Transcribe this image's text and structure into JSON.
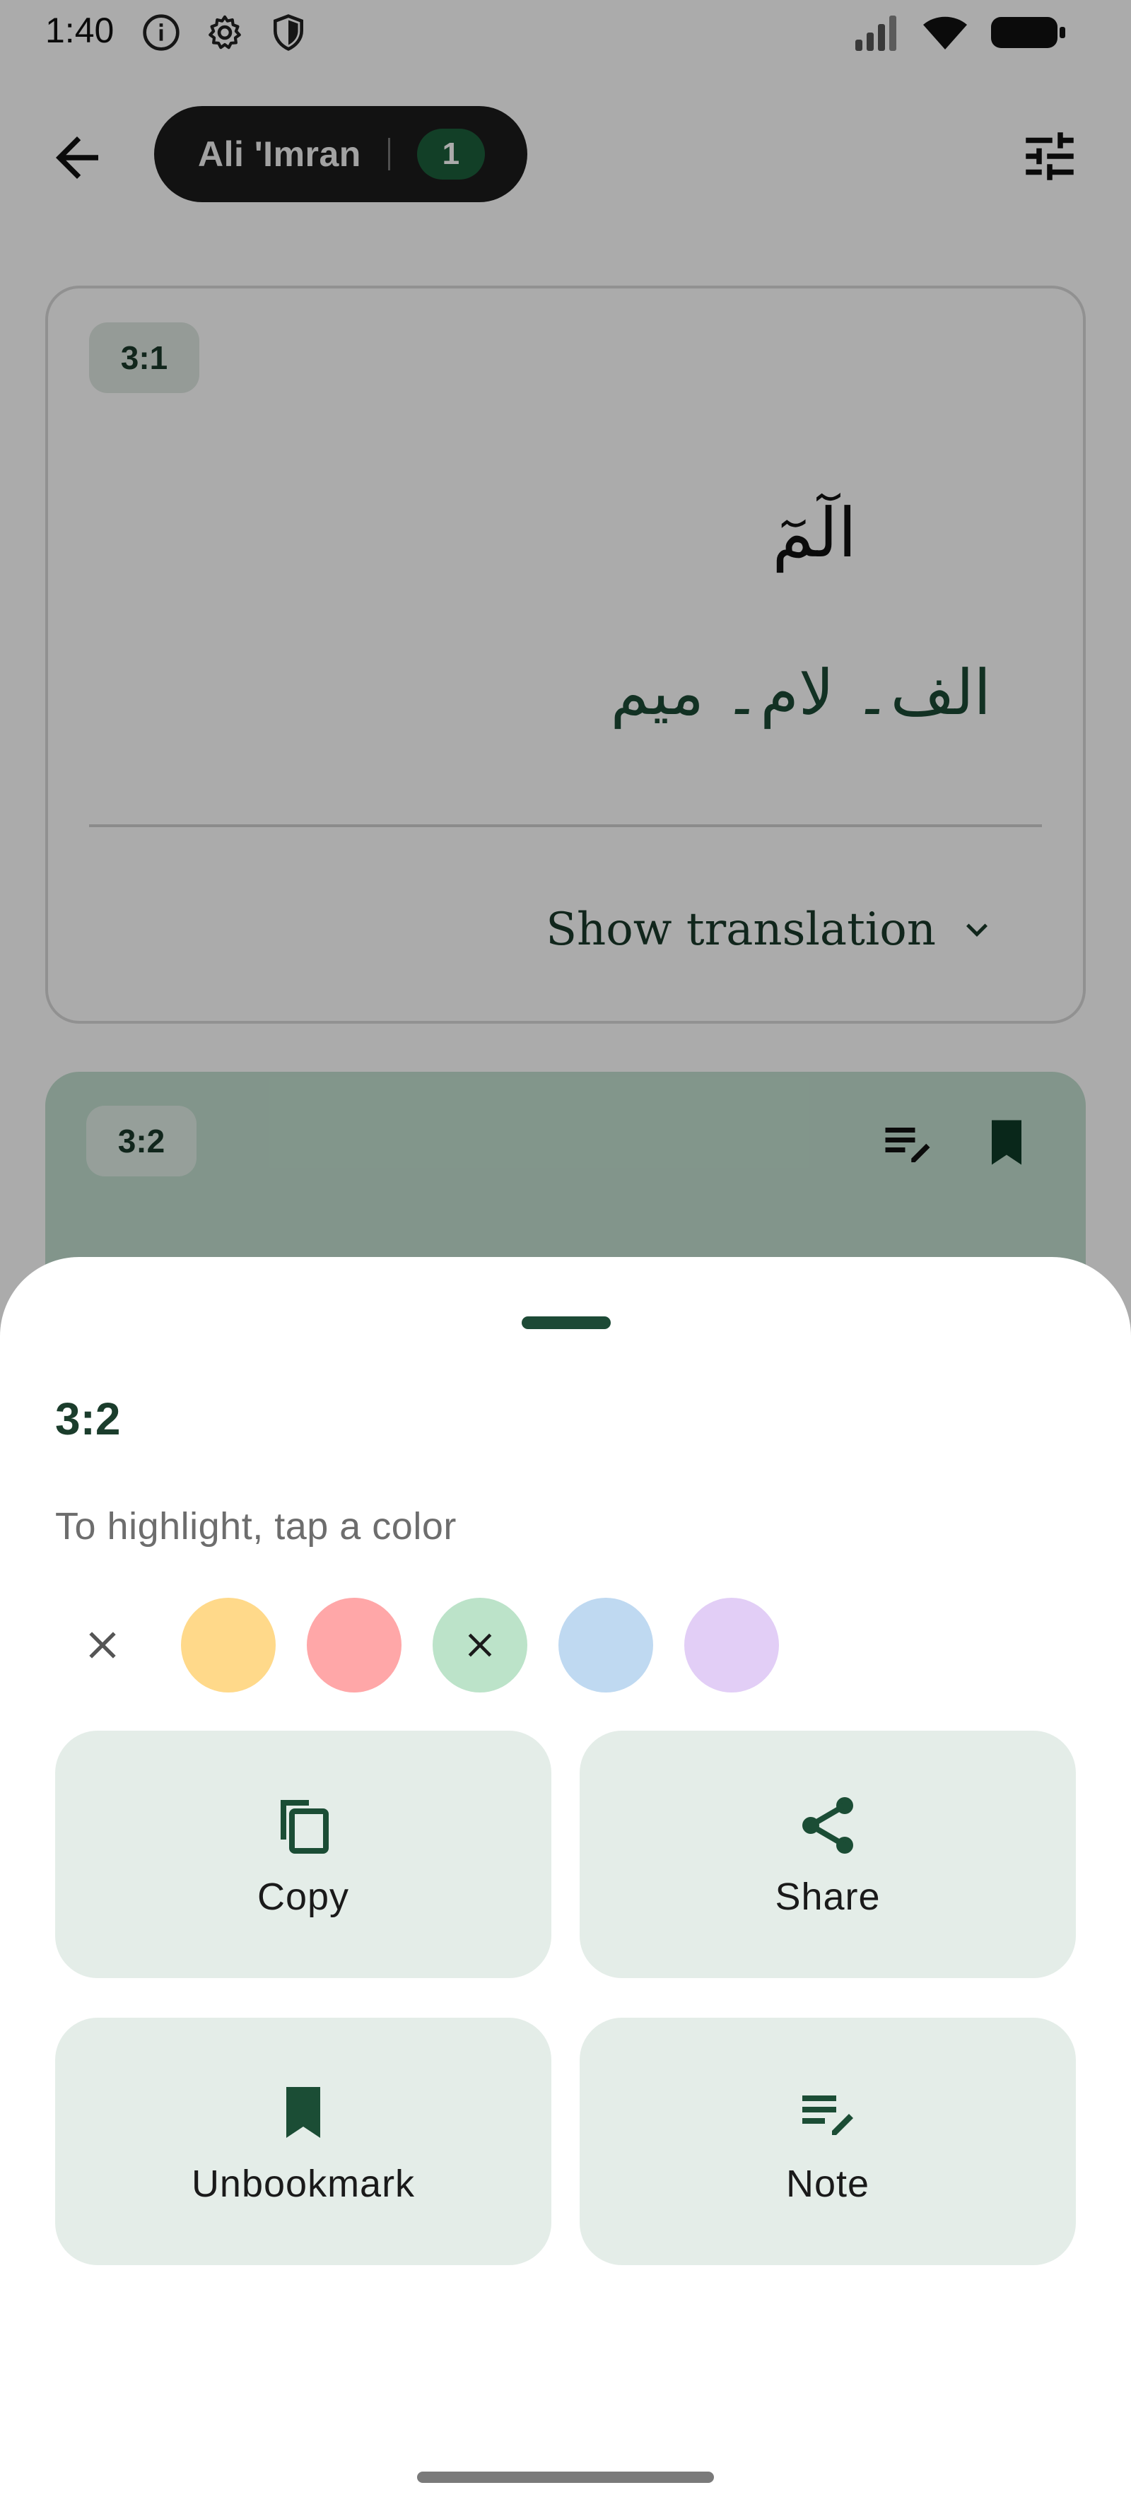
{
  "status_bar": {
    "time": "1:40"
  },
  "top_bar": {
    "surah_name": "Ali 'Imran",
    "surah_count": "1"
  },
  "verses": [
    {
      "badge": "3:1",
      "arabic": "الٓمٓ",
      "urdu": "الف۔ لام۔ میم",
      "show_translation": "Show translation"
    },
    {
      "badge": "3:2"
    }
  ],
  "sheet": {
    "title": "3:2",
    "hint": "To highlight, tap a color",
    "swatches": [
      "#FFD98A",
      "#FFA7A8",
      "#BCE3C9",
      "#BFD9F1",
      "#E2CEF6"
    ],
    "selected_swatch": 2,
    "actions": {
      "copy": "Copy",
      "share": "Share",
      "unbookmark": "Unbookmark",
      "note": "Note"
    }
  },
  "colors": {
    "accent": "#1B4D35",
    "tile_bg": "#E4EDE8",
    "highlight_green": "#C2DFCF"
  },
  "icons": [
    "back-arrow-icon",
    "tune-icon",
    "chevron-down-icon",
    "note-edit-icon",
    "bookmark-icon",
    "close-icon",
    "copy-icon",
    "share-icon"
  ]
}
